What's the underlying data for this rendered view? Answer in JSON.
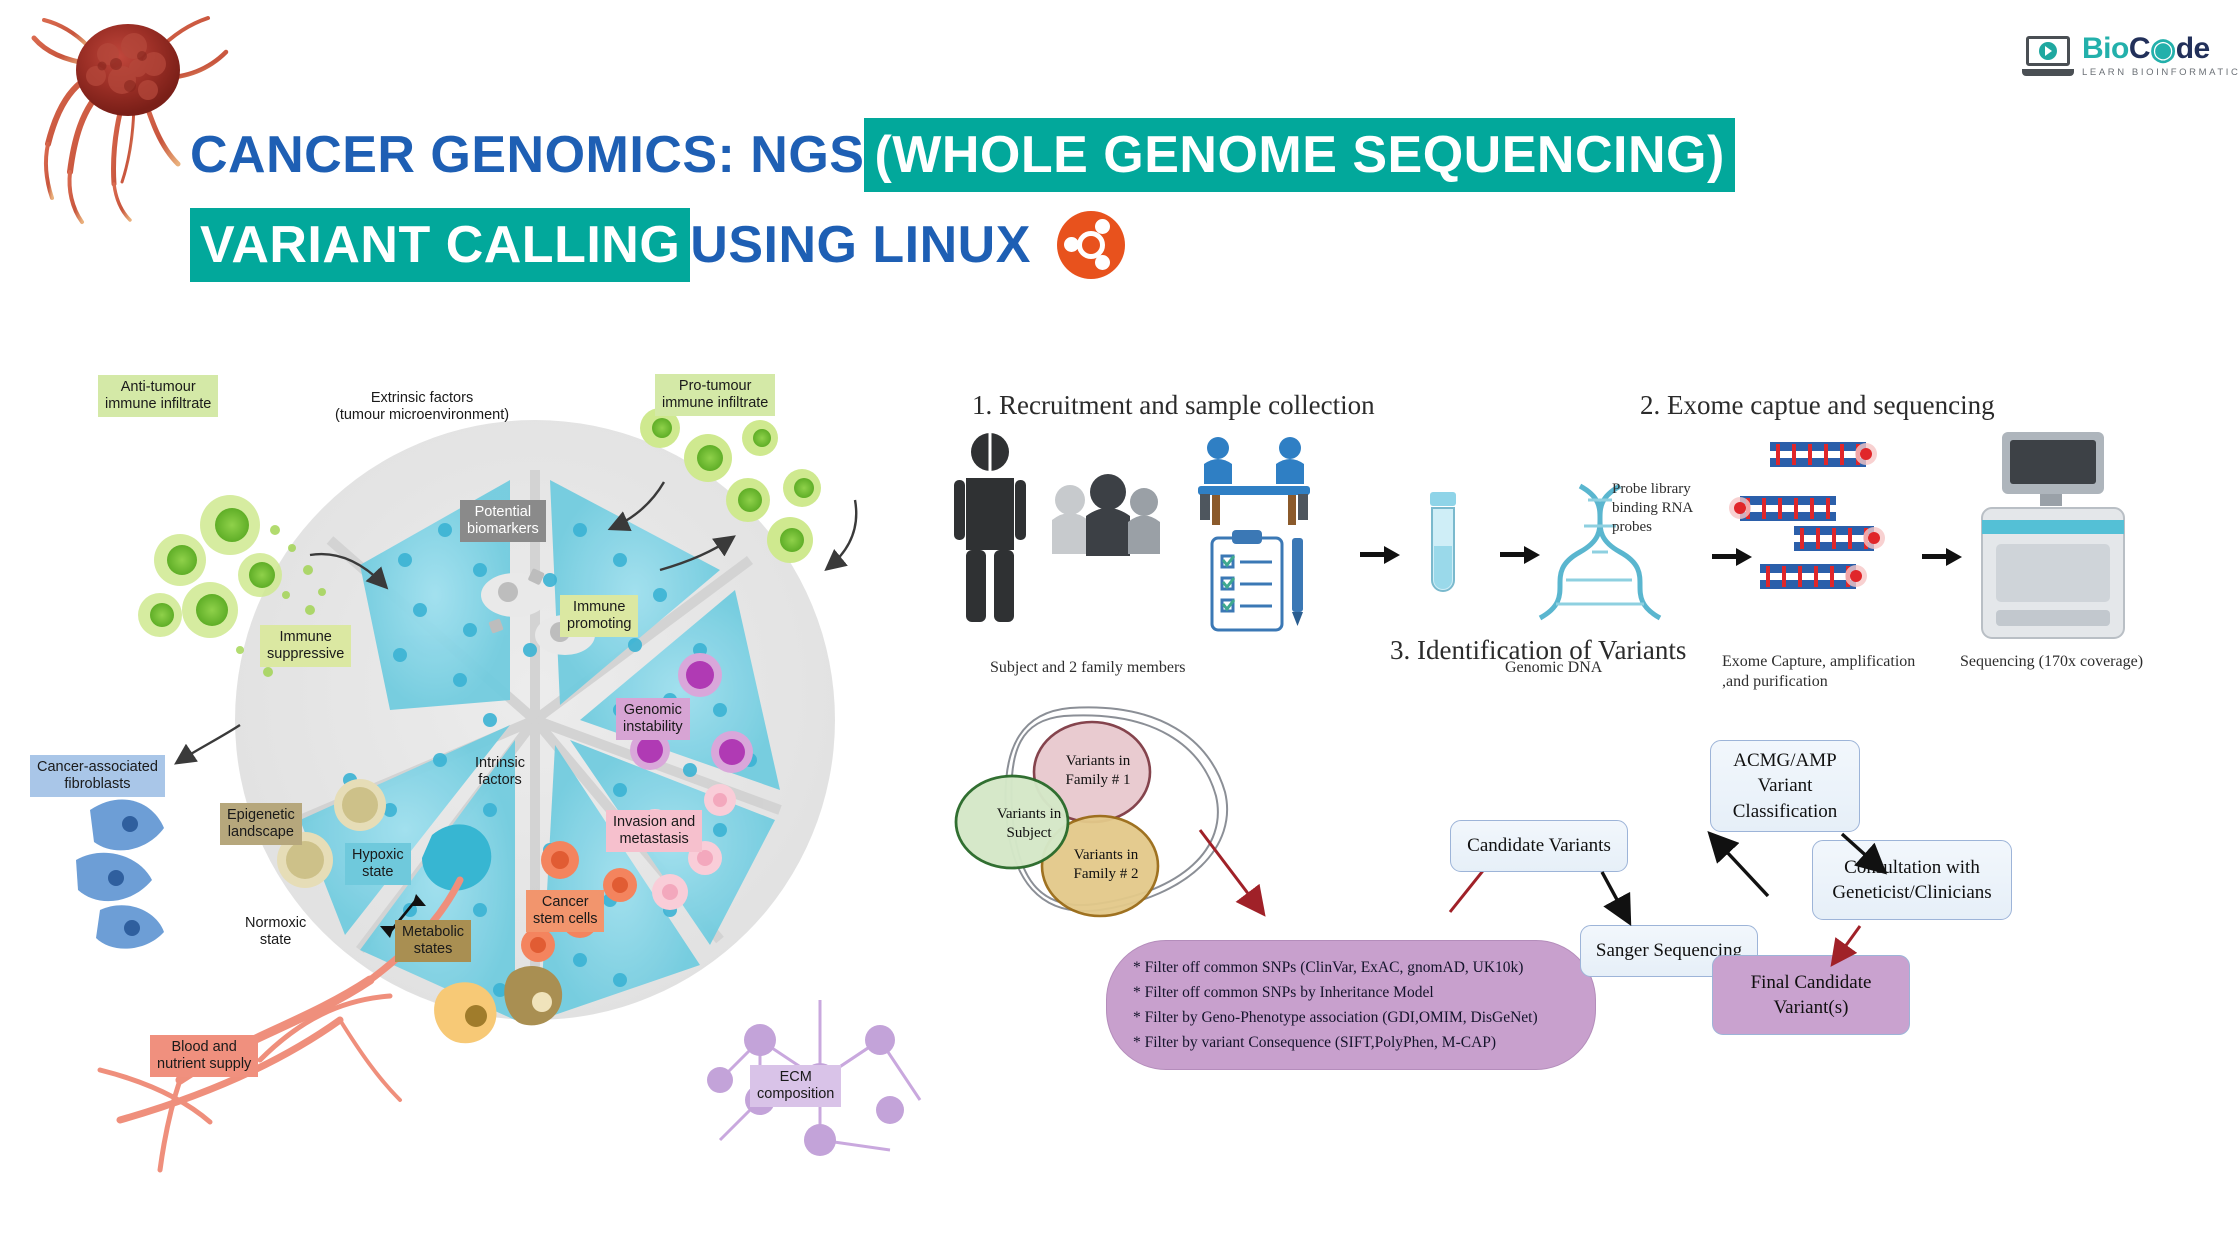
{
  "logo": {
    "word_part1": "Bio",
    "word_part2": "C",
    "word_part3": "de",
    "tagline": "LEARN BIOINFORMATICS",
    "teal": "#23b0ab",
    "dark": "#22305a"
  },
  "title": {
    "line1_plain": "CANCER GENOMICS: NGS ",
    "line1_highlight": "(WHOLE GENOME SEQUENCING)",
    "line2_highlight": "VARIANT CALLING",
    "line2_plain": " USING LINUX",
    "blue": "#1e5fb4",
    "highlight_bg": "#02a89b",
    "ubuntu_orange": "#e8521d"
  },
  "tme": {
    "center_label": "Intrinsic\nfactors",
    "extrinsic_label": "Extrinsic factors\n(tumour microenvironment)",
    "labels": [
      {
        "text": "Anti-tumour\nimmune infiltrate",
        "color": "#d4e9a7"
      },
      {
        "text": "Pro-tumour\nimmune infiltrate",
        "color": "#d4e9a7"
      },
      {
        "text": "Cancer-associated\nfibroblasts",
        "color": "#a9c6e8"
      },
      {
        "text": "Immune\nsuppressive",
        "color": "#dbe8a2"
      },
      {
        "text": "Potential\nbiomarkers",
        "color": "#8a8a8a"
      },
      {
        "text": "Immune\npromoting",
        "color": "#dbe8a2"
      },
      {
        "text": "Genomic\ninstability",
        "color": "#d7a4d4"
      },
      {
        "text": "Epigenetic\nlandscape",
        "color": "#b6a77c"
      },
      {
        "text": "Invasion and\nmetastasis",
        "color": "#f6c0cd"
      },
      {
        "text": "Hypoxic\nstate",
        "color": "#6fc9dc"
      },
      {
        "text": "Normoxic\nstate",
        "color": "transparent"
      },
      {
        "text": "Metabolic\nstates",
        "color": "#a98f52"
      },
      {
        "text": "Cancer\nstem cells",
        "color": "#f2956d"
      },
      {
        "text": "Blood and\nnutrient supply",
        "color": "#f0907e"
      },
      {
        "text": "ECM\ncomposition",
        "color": "#d9c3e8"
      }
    ]
  },
  "workflow": {
    "step1_title": "1. Recruitment and sample collection",
    "step2_title": "2. Exome captue and sequencing",
    "step3_title": "3. Identification of Variants",
    "caption_subject": "Subject and 2 family members",
    "caption_genomic_dna": "Genomic DNA",
    "caption_exome_capture": "Exome Capture, amplification ,and purification",
    "caption_sequencing": "Sequencing (170x coverage)",
    "probe_label": "Probe library binding  RNA probes"
  },
  "venn": {
    "subject": "Variants in\nSubject",
    "family1": "Variants in\nFamily # 1",
    "family2": "Variants in\nFamily # 2",
    "subject_color": "#d5e8c8",
    "family1_color": "#e8c9ce",
    "family2_color": "#e3c98a"
  },
  "filters": {
    "lines": [
      "* Filter off common SNPs (ClinVar,  ExAC, gnomAD, UK10k)",
      "* Filter off common SNPs by Inheritance Model",
      "* Filter by Geno-Phenotype association (GDI,OMIM, DisGeNet)",
      "* Filter by variant Consequence (SIFT,PolyPhen, M-CAP)"
    ],
    "bg_color": "#c8a0cd"
  },
  "flow": {
    "candidate_variants": "Candidate Variants",
    "sanger": "Sanger Sequencing",
    "acmg": "ACMG/AMP\nVariant\nClassification",
    "consultation": "Consultation with\nGeneticist/Clinicians",
    "final": "Final Candidate\nVariant(s)",
    "box_fill": "#eaf2fa",
    "box_border": "#9db4d8",
    "final_fill": "#c9a2cf"
  }
}
